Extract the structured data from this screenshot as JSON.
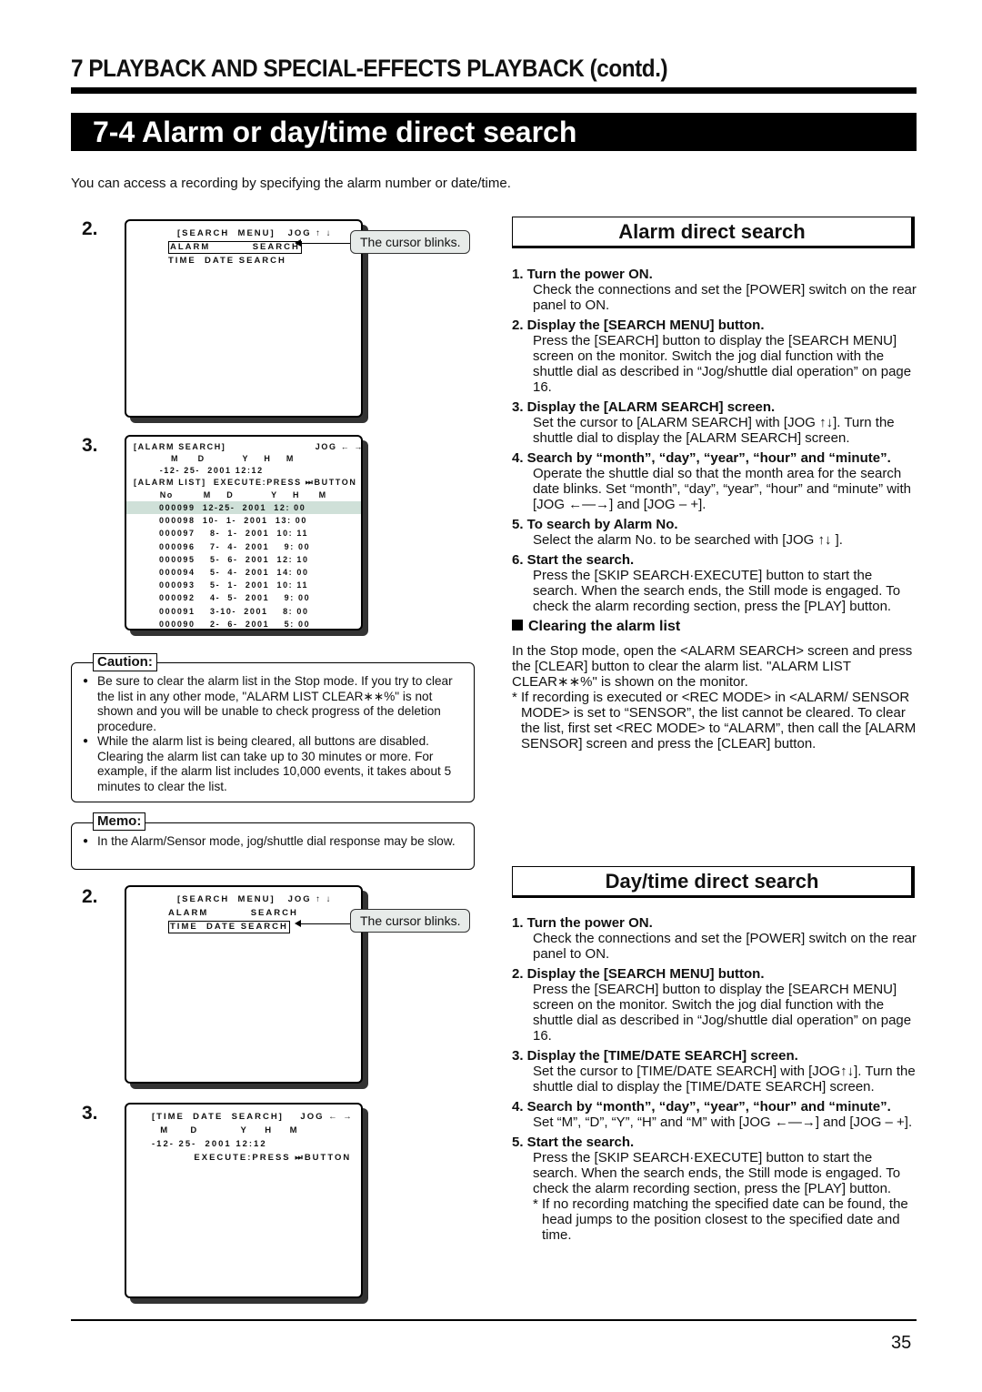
{
  "chapter": "7  PLAYBACK AND SPECIAL-EFFECTS PLAYBACK (contd.)",
  "section": "7-4 Alarm or day/time direct search",
  "intro": "You can access a recording by specifying the alarm number or date/time.",
  "callout": "The cursor blinks.",
  "alarm_steps_left": {
    "s2": "2.",
    "s3": "3."
  },
  "screen_menu": {
    "title": "[SEARCH  MENU]   JOG ↑ ↓",
    "alarm": "ALARM          SEARCH",
    "time": "TIME  DATE SEARCH"
  },
  "screen_alarm": {
    "title": "[ALARM SEARCH]                        JOG ← →",
    "hdr": "          M     D          Y    H    M",
    "date": "       -12- 25-  2001 12:12",
    "list": "[ALARM LIST]  EXECUTE:PRESS ⏭BUTTON",
    "cols": "       No        M    D          Y    H     M",
    "rows": [
      "000099  12-25-  2001  12: 00",
      "000098  10-  1-  2001  13: 00",
      "000097    8-  1-  2001  10: 11",
      "000096    7-  4-  2001    9: 00",
      "000095    5-  6-  2001  12: 10",
      "000094    5-  4-  2001  14: 00",
      "000093    5-  1-  2001  10: 11",
      "000092    4-  5-  2001    9: 00",
      "000091    3-10-  2001    8: 00",
      "000090    2-  6-  2001    5: 00"
    ]
  },
  "screen_time": {
    "title": "[TIME  DATE  SEARCH]    JOG ← →",
    "hdr": "  M     D          Y    H    M",
    "date": "-12- 25-  2001 12:12",
    "exec": "          EXECUTE:PRESS ⏭BUTTON"
  },
  "caution": {
    "label": "Caution:",
    "items": [
      "Be sure to clear the alarm list in the Stop mode. If you try to clear the list in any other mode, \"ALARM LIST CLEAR∗∗%\" is not shown and you will be unable to check progress of the deletion procedure.",
      "While the alarm list is being cleared, all buttons are disabled. Clearing the alarm list can take up to 30 minutes or more. For example, if the alarm list includes 10,000 events, it takes about 5 minutes to clear the list."
    ]
  },
  "memo": {
    "label": "Memo:",
    "items": [
      "In the Alarm/Sensor mode, jog/shuttle dial response may be slow."
    ]
  },
  "alarm": {
    "title": "Alarm direct search",
    "steps": [
      {
        "t": "1.  Turn the power ON.",
        "d": "Check the connections and set the [POWER] switch on the rear panel to ON."
      },
      {
        "t": "2.  Display the [SEARCH MENU] button.",
        "d": "Press the [SEARCH] button to display the [SEARCH MENU] screen on the monitor. Switch the jog dial function with the shuttle dial as described in “Jog/shuttle dial operation” on page 16."
      },
      {
        "t": "3.  Display the [ALARM SEARCH] screen.",
        "d": "Set the cursor to [ALARM SEARCH] with [JOG ↑↓]. Turn the shuttle dial to display the [ALARM SEARCH] screen."
      },
      {
        "t": "4.  Search by “month”, “day”, “year”, “hour” and “minute”.",
        "d": "Operate the shuttle dial so that the month area for the search date blinks. Set “month”, “day”, “year”, “hour” and “minute” with [JOG ←—→] and [JOG – +]."
      },
      {
        "t": "5.  To search by Alarm No.",
        "d": "Select the alarm No. to be searched with [JOG ↑↓ ]."
      },
      {
        "t": "6.  Start the search.",
        "d": "Press the [SKIP SEARCH·EXECUTE] button to start the search. When the search ends, the Still mode is engaged.  To check the alarm recording section, press the [PLAY] button."
      }
    ],
    "clear_title": "Clearing the alarm list",
    "clear_text": "In the Stop mode, open the <ALARM SEARCH> screen and press the [CLEAR] button to clear the alarm list. \"ALARM LIST CLEAR∗∗%\" is shown on the monitor.",
    "clear_note": "* If recording is executed or <REC MODE> in <ALARM/ SENSOR MODE> is set to “SENSOR”, the list cannot be cleared.  To clear the list, first set <REC MODE> to “ALARM”, then call the [ALARM SENSOR] screen and press the [CLEAR] button."
  },
  "daytime": {
    "title": "Day/time direct search",
    "steps": [
      {
        "t": "1.  Turn the power ON.",
        "d": "Check the connections and set the [POWER] switch on the rear panel to ON."
      },
      {
        "t": "2.  Display the [SEARCH MENU] button.",
        "d": "Press the [SEARCH] button to display the [SEARCH MENU] screen on the monitor. Switch the jog dial function with the shuttle dial as described in “Jog/shuttle dial operation” on page 16."
      },
      {
        "t": "3.  Display the [TIME/DATE SEARCH] screen.",
        "d": "Set the cursor to [TIME/DATE SEARCH] with [JOG↑↓]. Turn the shuttle dial to display the [TIME/DATE SEARCH] screen."
      },
      {
        "t": "4.  Search by “month”, “day”, “year”, “hour” and “minute”.",
        "d": "Set “M”, “D”, “Y”, “H” and “M” with [JOG ←—→] and [JOG – +]."
      },
      {
        "t": "5.  Start the search.",
        "d": "Press the [SKIP SEARCH·EXECUTE] button to start the search. When the search ends, the Still mode is engaged.  To check the alarm recording section, press the [PLAY] button."
      }
    ],
    "note": "* If no recording matching the specified date can be found, the head jumps to the position closest to the specified date and time."
  },
  "page_number": "35"
}
